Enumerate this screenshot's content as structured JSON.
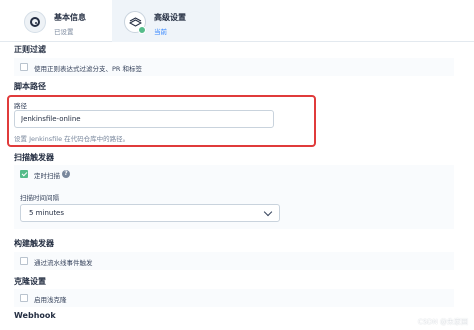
{
  "steps": [
    {
      "title": "基本信息",
      "subtitle": "已设置"
    },
    {
      "title": "高级设置",
      "subtitle": "当前"
    }
  ],
  "regex_filter": {
    "heading": "正则过滤",
    "checkbox_label": "使用正则表达式过滤分支、PR 和标签",
    "checked": false
  },
  "script_path": {
    "heading": "脚本路径",
    "field_label": "路径",
    "value": "Jenkinsfile-online",
    "hint": "设置 Jenkinsfile 在代码仓库中的路径。"
  },
  "scan_trigger": {
    "heading": "扫描触发器",
    "checkbox_label": "定时扫描",
    "checked": true,
    "interval_label": "扫描时间间隔",
    "interval_value": "5 minutes"
  },
  "build_trigger": {
    "heading": "构建触发器",
    "checkbox_label": "通过流水线事件触发",
    "checked": false
  },
  "clone_settings": {
    "heading": "克隆设置",
    "checkbox_label": "启用浅克隆",
    "checked": false
  },
  "webhook": {
    "heading": "Webhook"
  },
  "watermark": "CSDN @朱家园",
  "colors": {
    "accent_green": "#55bc8a",
    "highlight_red": "#e03b3b",
    "active_blue": "#3385ff"
  },
  "icons": {
    "basic_step": "target-icon",
    "advanced_step": "gear-icon",
    "help": "question-icon",
    "select": "chevron-down-icon"
  }
}
